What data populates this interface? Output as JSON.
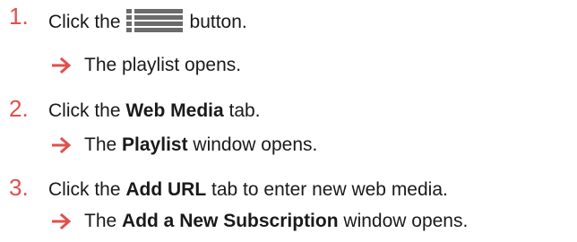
{
  "steps": [
    {
      "number": "1.",
      "before": "Click the",
      "icon": "playlist-menu-icon",
      "after": "button.",
      "result": "The playlist opens."
    },
    {
      "number": "2.",
      "before": "Click the ",
      "bold": "Web Media",
      "after": " tab.",
      "result_before": "The ",
      "result_bold": "Playlist",
      "result_after": " window opens."
    },
    {
      "number": "3.",
      "before": "Click the ",
      "bold": "Add URL",
      "after": " tab to enter new web media.",
      "result_before": "The ",
      "result_bold": "Add a New Subscription",
      "result_after": " window opens."
    }
  ],
  "colors": {
    "accent": "#e0504a",
    "text": "#1a1a1a",
    "icon": "#6b6b6b"
  }
}
